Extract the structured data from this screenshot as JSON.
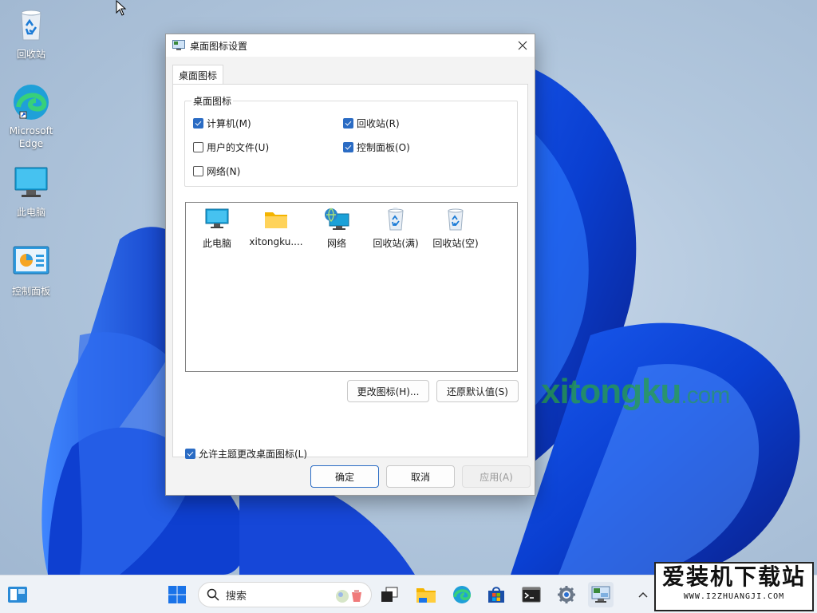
{
  "desktop": {
    "icons": [
      {
        "label": "回收站",
        "icon": "recycle-bin-icon"
      },
      {
        "label": "Microsoft\nEdge",
        "icon": "edge-icon"
      },
      {
        "label": "此电脑",
        "icon": "computer-icon"
      },
      {
        "label": "控制面板",
        "icon": "control-panel-icon"
      }
    ],
    "watermark_main": "xitongku",
    "watermark_suffix": ".com"
  },
  "dialog": {
    "title": "桌面图标设置",
    "tab": "桌面图标",
    "group_title": "桌面图标",
    "checkboxes": [
      {
        "label": "计算机(M)",
        "checked": true
      },
      {
        "label": "回收站(R)",
        "checked": true
      },
      {
        "label": "用户的文件(U)",
        "checked": false
      },
      {
        "label": "控制面板(O)",
        "checked": true
      },
      {
        "label": "网络(N)",
        "checked": false
      }
    ],
    "icon_list": [
      {
        "label": "此电脑",
        "icon": "monitor-icon"
      },
      {
        "label": "xitongku....",
        "icon": "folder-icon"
      },
      {
        "label": "网络",
        "icon": "network-icon"
      },
      {
        "label": "回收站(满)",
        "icon": "recycle-bin-full-icon"
      },
      {
        "label": "回收站(空)",
        "icon": "recycle-bin-empty-icon"
      }
    ],
    "change_icon_button": "更改图标(H)...",
    "restore_default_button": "还原默认值(S)",
    "allow_themes_label": "允许主题更改桌面图标(L)",
    "allow_themes_checked": true,
    "ok_button": "确定",
    "cancel_button": "取消",
    "apply_button": "应用(A)"
  },
  "taskbar": {
    "search_placeholder": "搜索"
  },
  "brand": {
    "name": "爱装机下载站",
    "url": "WWW.I2ZHUANGJI.COM"
  },
  "colors": {
    "accent": "#2b6cc4",
    "watermark": "#28a046"
  }
}
